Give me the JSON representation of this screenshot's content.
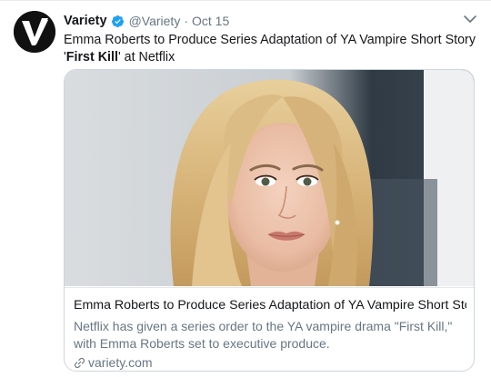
{
  "tweet": {
    "author_name": "Variety",
    "handle": "@Variety",
    "separator": "·",
    "date": "Oct 15",
    "text_part1": "Emma Roberts to Produce Series Adaptation of YA Vampire Short Story '",
    "text_bold": "First Kill",
    "text_part2": "' at Netflix"
  },
  "card": {
    "title": "Emma Roberts to Produce Series Adaptation of YA Vampire Short Story ...",
    "description": "Netflix has given a series order to the YA vampire drama \"First Kill,\" with Emma Roberts set to executive produce.",
    "domain": "variety.com"
  },
  "icons": {
    "avatar": "variety-v-logo",
    "verified": "verified-badge-icon",
    "caret": "chevron-down-icon",
    "link": "link-icon"
  },
  "colors": {
    "verified_blue": "#1da1f2",
    "text_primary": "#14171a",
    "text_secondary": "#657786",
    "border": "#ccd6dd"
  }
}
